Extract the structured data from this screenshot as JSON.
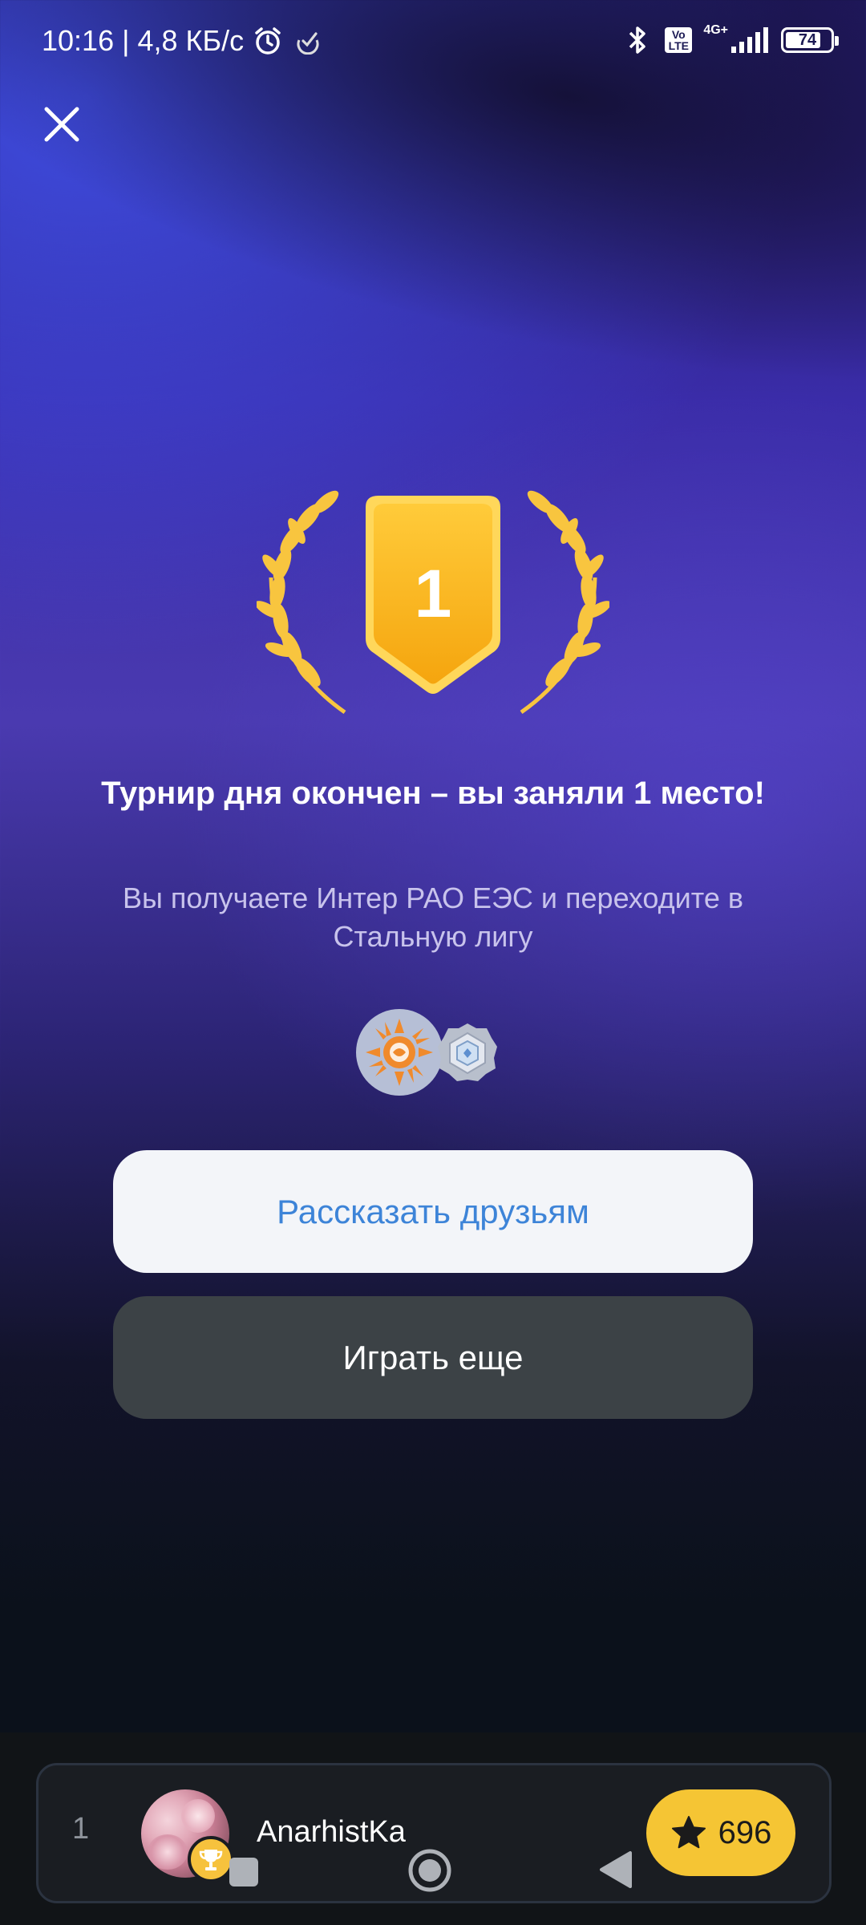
{
  "status_bar": {
    "time": "10:16",
    "separator": "|",
    "net_speed": "4,8 КБ/с",
    "network": "4G+",
    "volte": "Vo LTE",
    "battery": "74",
    "icons": [
      "alarm-icon",
      "signal-check-icon",
      "bluetooth-icon",
      "volte-icon",
      "cellular-signal-icon",
      "battery-icon"
    ]
  },
  "result": {
    "place_number": "1",
    "title": "Турнир дня окончен – вы заняли 1 место!",
    "subtitle": "Вы получаете Интер РАО ЕЭС и переходите в Стальную лигу"
  },
  "rewards": [
    "company-logo-icon",
    "steel-league-badge-icon"
  ],
  "buttons": {
    "share": "Рассказать друзьям",
    "play_again": "Играть еще"
  },
  "leaderboard": {
    "rank": "1",
    "username": "AnarhistKa",
    "score": "696"
  },
  "colors": {
    "accent_gold": "#f5c534",
    "share_text": "#3d84d8",
    "background_top": "#3a2ca8",
    "background_bottom": "#0b111b"
  }
}
